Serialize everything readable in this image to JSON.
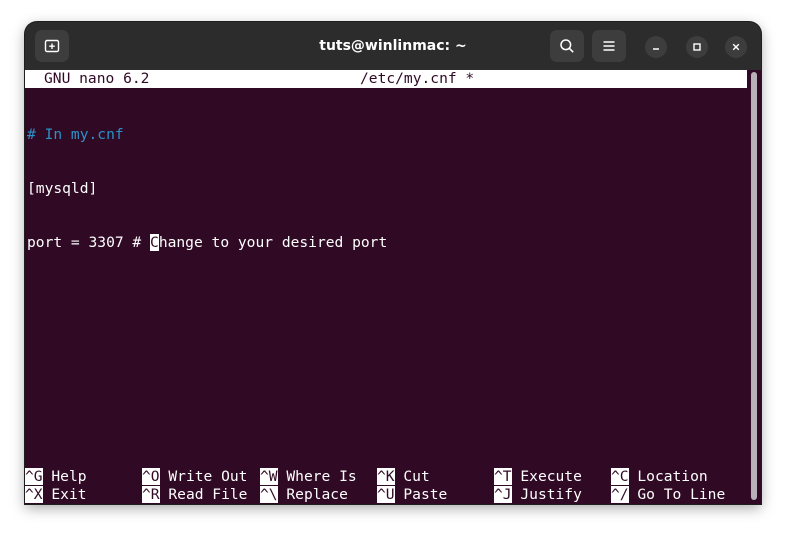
{
  "window": {
    "title": "tuts@winlinmac: ~"
  },
  "nano": {
    "version": "GNU nano 6.2",
    "filename": "/etc/my.cnf *"
  },
  "editor": {
    "line1": "# In my.cnf",
    "line2": "[mysqld]",
    "line3_before_cursor": "port = 3307 # ",
    "line3_cursor_char": "C",
    "line3_after_cursor": "hange to your desired port"
  },
  "shortcuts": {
    "row1": [
      {
        "key": "^G",
        "label": "Help"
      },
      {
        "key": "^O",
        "label": "Write Out"
      },
      {
        "key": "^W",
        "label": "Where Is"
      },
      {
        "key": "^K",
        "label": "Cut"
      },
      {
        "key": "^T",
        "label": "Execute"
      },
      {
        "key": "^C",
        "label": "Location"
      }
    ],
    "row2": [
      {
        "key": "^X",
        "label": "Exit"
      },
      {
        "key": "^R",
        "label": "Read File"
      },
      {
        "key": "^\\",
        "label": "Replace"
      },
      {
        "key": "^U",
        "label": "Paste"
      },
      {
        "key": "^J",
        "label": "Justify"
      },
      {
        "key": "^/",
        "label": "Go To Line"
      }
    ]
  },
  "colors": {
    "terminal_bg": "#300a24",
    "titlebar_bg": "#2c2c2c",
    "comment": "#2a92c7"
  }
}
